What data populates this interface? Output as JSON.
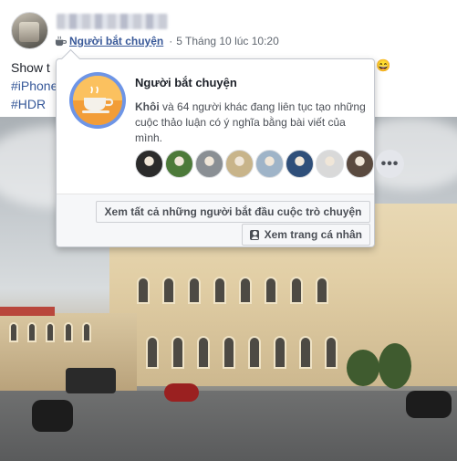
{
  "post": {
    "author_avatar": "avatar",
    "badge": {
      "icon": "conversation-starter-cup-icon",
      "label": "Người bắt chuyện"
    },
    "timestamp": "5 Tháng 10 lúc 10:20",
    "text_line1_prefix": "Show t",
    "hashtags": [
      "#iPhone",
      "#HDR"
    ],
    "tail_emoji": "😄"
  },
  "hovercard": {
    "title": "Người bắt chuyện",
    "desc_name": "Khôi",
    "desc_rest": " và 64 người khác đang liên tục tạo những cuộc thảo luận có ý nghĩa bằng bài viết của mình.",
    "avatars": [
      {
        "name": "friend-avatar-1",
        "color": "#2b2b2b"
      },
      {
        "name": "friend-avatar-2",
        "color": "#4d7a3a"
      },
      {
        "name": "friend-avatar-3",
        "color": "#8a8f94"
      },
      {
        "name": "friend-avatar-4",
        "color": "#c8b48a"
      },
      {
        "name": "friend-avatar-5",
        "color": "#9fb4c8"
      },
      {
        "name": "friend-avatar-6",
        "color": "#2f4f7a"
      },
      {
        "name": "friend-avatar-7",
        "color": "#d9d9d9"
      },
      {
        "name": "friend-avatar-8",
        "color": "#5a4a3f"
      }
    ],
    "more_label": "•••",
    "see_all_button": "Xem tất cả những người bắt đầu cuộc trò chuyện",
    "profile_button": "Xem trang cá nhân"
  },
  "colors": {
    "link": "#385898",
    "badge_ring": "#6e95e6",
    "badge_fill": "#fbb848"
  }
}
